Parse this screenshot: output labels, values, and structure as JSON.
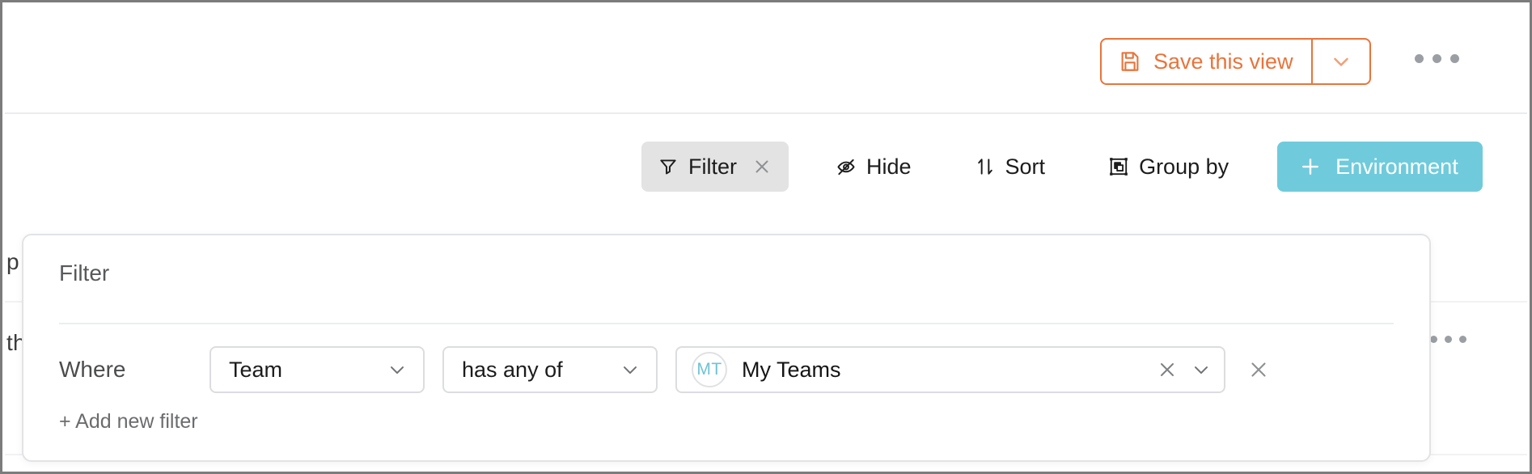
{
  "theme": {
    "accent_orange": "#e8743b",
    "accent_teal": "#6fcbdc",
    "avatar_teal": "#6fc3d4",
    "active_chip_bg": "#e3e3e3",
    "border_gray": "#dcdddf",
    "text_dark": "#1c1c1c",
    "text_muted": "#6b6c6e"
  },
  "background": {
    "text_fragment_1": "p",
    "text_fragment_2": "th",
    "row_kebab": "row-more-menu"
  },
  "topbar": {
    "save_label": "Save this view",
    "save_icon": "floppy-disk-save-icon",
    "save_caret_icon": "chevron-down-icon",
    "more_menu": "more-options-icon"
  },
  "toolbar": {
    "buttons": [
      {
        "label": "Filter",
        "icon": "funnel-icon",
        "active": true,
        "has_close": true
      },
      {
        "label": "Hide",
        "icon": "eye-off-icon",
        "active": false,
        "has_close": false
      },
      {
        "label": "Sort",
        "icon": "sort-arrows-icon",
        "active": false,
        "has_close": false
      },
      {
        "label": "Group by",
        "icon": "group-by-icon",
        "active": false,
        "has_close": false
      }
    ],
    "filter_close_icon": "close-icon",
    "primary_action": {
      "label": "Environment",
      "icon": "plus-icon"
    }
  },
  "filter_panel": {
    "title": "Filter",
    "where_label": "Where",
    "field": {
      "value": "Team",
      "caret_icon": "chevron-down-icon"
    },
    "operator": {
      "value": "has any of",
      "caret_icon": "chevron-down-icon"
    },
    "value": {
      "avatar_initials": "MT",
      "text": "My Teams",
      "clear_icon": "close-icon",
      "caret_icon": "chevron-down-icon"
    },
    "remove_row_icon": "close-icon",
    "add_filter_label": "+ Add new filter"
  }
}
